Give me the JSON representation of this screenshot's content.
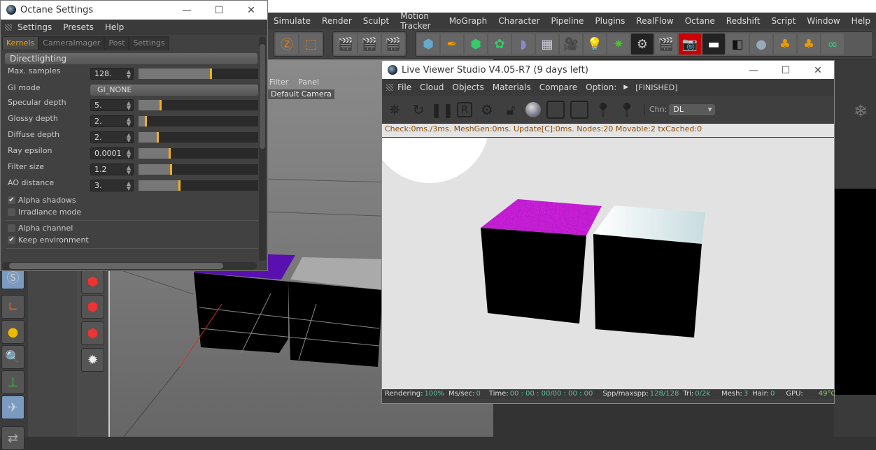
{
  "main_menu": [
    "Simulate",
    "Render",
    "Sculpt",
    "Motion Tracker",
    "MoGraph",
    "Character",
    "Pipeline",
    "Plugins",
    "RealFlow",
    "Octane",
    "Redshift",
    "Script",
    "Window",
    "Help"
  ],
  "viewport": {
    "menu": [
      "Filter",
      "Panel"
    ],
    "camera": "Default Camera"
  },
  "octane_settings": {
    "title": "Octane Settings",
    "menu": [
      "Settings",
      "Presets",
      "Help"
    ],
    "tabs": [
      "Kernels",
      "CameraImager",
      "Post",
      "Settings"
    ],
    "active_tab": "Kernels",
    "section": "Directlighting",
    "params": [
      {
        "label": "Max. samples",
        "value": "128.",
        "fraction": 0.6
      },
      {
        "label": "Specular depth",
        "value": "5.",
        "fraction": 0.18
      },
      {
        "label": "Glossy depth",
        "value": "2.",
        "fraction": 0.06
      },
      {
        "label": "Diffuse depth",
        "value": "2.",
        "fraction": 0.16
      },
      {
        "label": "Ray epsilon",
        "value": "0.0001",
        "fraction": 0.26
      },
      {
        "label": "Filter size",
        "value": "1.2",
        "fraction": 0.27
      },
      {
        "label": "AO distance",
        "value": "3.",
        "fraction": 0.34
      }
    ],
    "gi_mode": {
      "label": "GI mode",
      "value": "GI_NONE"
    },
    "checkboxes": [
      {
        "label": "Alpha shadows",
        "checked": true
      },
      {
        "label": "Irradiance mode",
        "checked": false
      },
      {
        "label": "Alpha channel",
        "checked": false
      },
      {
        "label": "Keep environment",
        "checked": true
      }
    ]
  },
  "live_viewer": {
    "title": "Live Viewer Studio V4.05-R7 (9 days left)",
    "menu": [
      "File",
      "Cloud",
      "Objects",
      "Materials",
      "Compare",
      "Option:"
    ],
    "state": "[FINISHED]",
    "channel_label": "Chn:",
    "channel": "DL",
    "status_line": "Check:0ms./3ms. MeshGen:0ms. Update[C]:0ms. Nodes:20 Movable:2 txCached:0",
    "footer": {
      "rendering_label": "Rendering:",
      "rendering": "100%",
      "ms_label": "Ms/sec:",
      "ms": "0",
      "time_label": "Time:",
      "time": "00 : 00 : 00/00 : 00 : 00",
      "spp_label": "Spp/maxspp:",
      "spp": "128/128",
      "tri_label": "Tri:",
      "tri": "0/2k",
      "mesh_label": "Mesh:",
      "mesh": "3",
      "hair_label": "Hair:",
      "hair": "0",
      "gpu_label": "GPU:",
      "gpu": "49°C"
    },
    "colors": {
      "magenta": "#d020e0",
      "status_text": "#8a4a00",
      "accent": "#f0b020"
    }
  }
}
